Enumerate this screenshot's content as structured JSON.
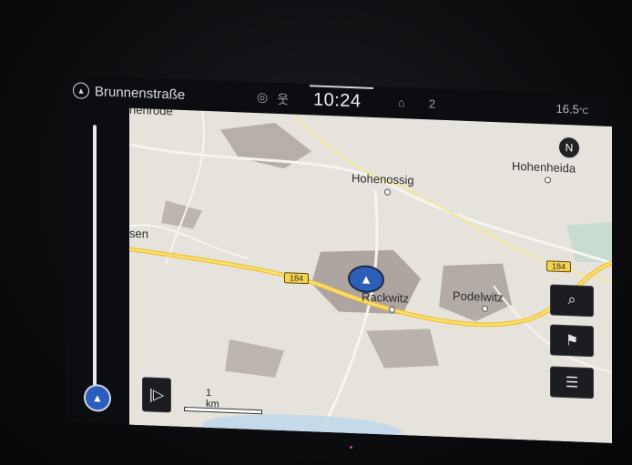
{
  "status": {
    "street": "Brunnenstraße",
    "time": "10:24",
    "temperature": "16.5",
    "temperature_unit": "°C",
    "badge": "2"
  },
  "map": {
    "places": {
      "hohenossig": "Hohenossig",
      "hohenheida": "Hohenheida",
      "rackwitz": "Rackwitz",
      "podelwitz": "Podelwitz",
      "sen": "sen",
      "top_partial": "henrode"
    },
    "road_shields": [
      "184",
      "184"
    ],
    "compass": "N",
    "scale": "1 km"
  },
  "buttons": {
    "menu_glyph": "☰",
    "play_glyph": "|▷"
  },
  "colors": {
    "road_main": "#f0c640",
    "land": "#e6e3dc",
    "settlement": "#b0a8a4",
    "position_marker": "#2e5fb8"
  }
}
